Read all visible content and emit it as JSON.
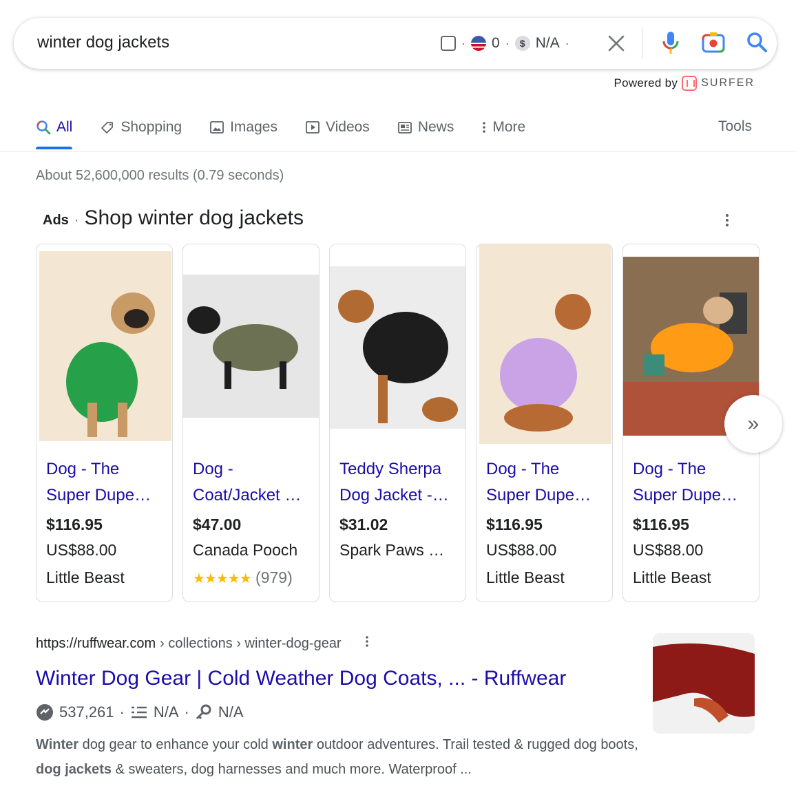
{
  "search": {
    "query": "winter dog jackets",
    "widget_count": "0",
    "widget_value": "N/A"
  },
  "powered_by": {
    "label": "Powered by",
    "brand": "SURFER"
  },
  "tabs": [
    {
      "label": "All",
      "icon": "search-icon"
    },
    {
      "label": "Shopping",
      "icon": "tag-icon"
    },
    {
      "label": "Images",
      "icon": "image-icon"
    },
    {
      "label": "Videos",
      "icon": "play-icon"
    },
    {
      "label": "News",
      "icon": "news-icon"
    },
    {
      "label": "More",
      "icon": "more-vert-icon"
    }
  ],
  "tools_label": "Tools",
  "stats": "About 52,600,000 results (0.79 seconds)",
  "ads": {
    "label": "Ads",
    "title": "Shop winter dog jackets",
    "products": [
      {
        "title": "Dog - The Super Dupe…",
        "price": "$116.95",
        "line2": "US$88.00",
        "line3": "Little Beast",
        "bg": "#f3e6d2",
        "coat": "#27a04a"
      },
      {
        "title": "Dog - Coat/Jacket …",
        "price": "$47.00",
        "line2": "Canada Pooch",
        "rating_stars": "★★★★★",
        "rating_count": "(979)",
        "bg": "#e6e6e6",
        "coat": "#6b7152"
      },
      {
        "title": "Teddy Sherpa Dog Jacket -…",
        "price": "$31.02",
        "line2": "Spark Paws …",
        "bg": "#ececec",
        "coat": "#1d1d1d"
      },
      {
        "title": "Dog - The Super Dupe…",
        "price": "$116.95",
        "line2": "US$88.00",
        "line3": "Little Beast",
        "bg": "#f3e6d2",
        "coat": "#c9a3e6"
      },
      {
        "title": "Dog - The Super Dupe…",
        "price": "$116.95",
        "line2": "US$88.00",
        "line3": "Little Beast",
        "bg": "#8a6e52",
        "coat": "#ff9b14"
      }
    ]
  },
  "next_label": "»",
  "result": {
    "url": "https://ruffwear.com",
    "crumbs": "› collections › winter-dog-gear",
    "title": "Winter Dog Gear | Cold Weather Dog Coats, ... - Ruffwear",
    "traffic": "537,261",
    "metric2": "N/A",
    "metric3": "N/A",
    "snippet_parts": [
      "Winter",
      " dog gear to enhance your cold ",
      "winter",
      " outdoor adventures. Trail tested & rugged dog boots, ",
      "dog jackets",
      " & sweaters, dog harnesses and much more. Waterproof ..."
    ]
  },
  "colors": {
    "link": "#1a0dab",
    "accent": "#1a73e8",
    "star": "#fbbc04"
  }
}
